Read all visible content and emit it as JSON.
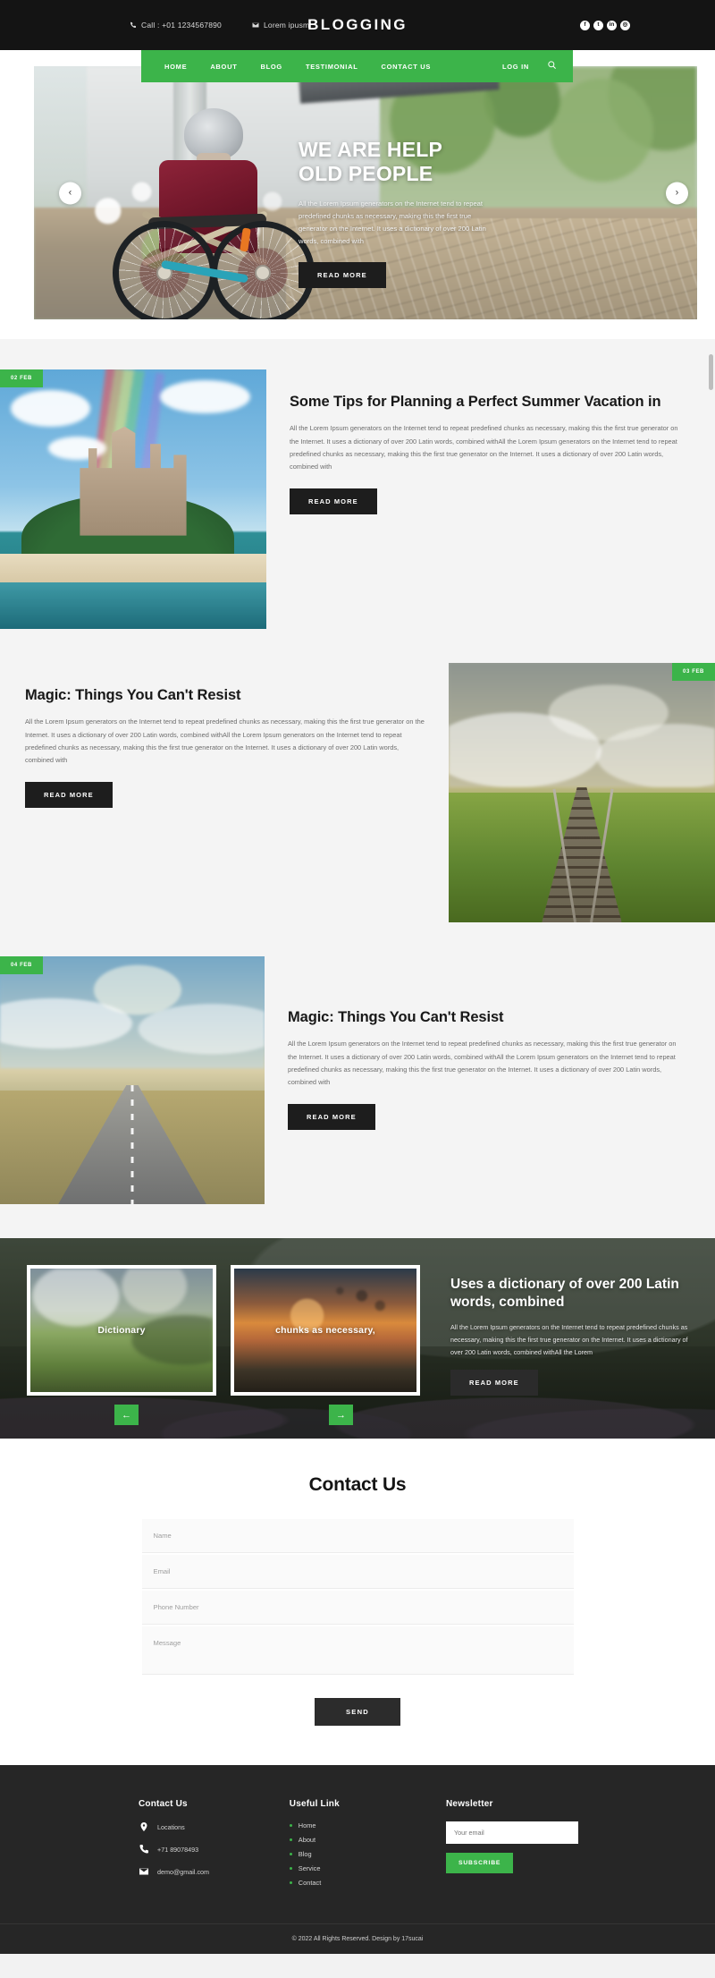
{
  "topbar": {
    "phone_icon": "phone-icon",
    "phone": "Call : +01 1234567890",
    "mail_icon": "mail-icon",
    "mail": "Lorem ipusm",
    "brand": "BLOGGING",
    "socials": [
      {
        "name": "facebook-icon",
        "glyph": "f"
      },
      {
        "name": "twitter-icon",
        "glyph": "t"
      },
      {
        "name": "linkedin-icon",
        "glyph": "in"
      },
      {
        "name": "instagram-icon",
        "glyph": "◎"
      }
    ]
  },
  "nav": {
    "items": [
      {
        "label": "HOME"
      },
      {
        "label": "ABOUT"
      },
      {
        "label": "BLOG"
      },
      {
        "label": "TESTIMONIAL"
      },
      {
        "label": "CONTACT US"
      }
    ],
    "login_label": "LOG IN",
    "search_icon": "search-icon",
    "accent_color": "#3cb44a"
  },
  "hero": {
    "title_line1": "WE ARE HELP",
    "title_line2": "OLD PEOPLE",
    "text": "All the Lorem Ipsum generators on the Internet tend to repeat predefined chunks as necessary, making this the first true generator on the Internet. It uses a dictionary of over 200 Latin words, combined with",
    "button": "READ MORE",
    "prev_icon": "chevron-left-icon",
    "next_icon": "chevron-right-icon",
    "prev_glyph": "‹",
    "next_glyph": "›"
  },
  "blog": {
    "posts": [
      {
        "date": "02 FEB",
        "title": "Some Tips for Planning a Perfect Summer Vacation in",
        "text": "All the Lorem Ipsum generators on the Internet tend to repeat predefined chunks as necessary, making this the first true generator on the Internet. It uses a dictionary of over 200 Latin words, combined withAll the Lorem Ipsum generators on the Internet tend to repeat predefined chunks as necessary, making this the first true generator on the Internet. It uses a dictionary of over 200 Latin words, combined with",
        "button": "READ MORE",
        "image": "castle-rainbow-photo"
      },
      {
        "date": "03 FEB",
        "title": "Magic: Things You Can't Resist",
        "text": "All the Lorem Ipsum generators on the Internet tend to repeat predefined chunks as necessary, making this the first true generator on the Internet. It uses a dictionary of over 200 Latin words, combined withAll the Lorem Ipsum generators on the Internet tend to repeat predefined chunks as necessary, making this the first true generator on the Internet. It uses a dictionary of over 200 Latin words, combined with",
        "button": "READ MORE",
        "image": "railway-track-photo"
      },
      {
        "date": "04 FEB",
        "title": "Magic: Things You Can't Resist",
        "text": "All the Lorem Ipsum generators on the Internet tend to repeat predefined chunks as necessary, making this the first true generator on the Internet. It uses a dictionary of over 200 Latin words, combined withAll the Lorem Ipsum generators on the Internet tend to repeat predefined chunks as necessary, making this the first true generator on the Internet. It uses a dictionary of over 200 Latin words, combined with",
        "button": "READ MORE",
        "image": "open-road-photo"
      }
    ]
  },
  "gallery": {
    "cards": [
      {
        "caption": "Dictionary",
        "image": "green-valley-photo"
      },
      {
        "caption": "chunks as necessary,",
        "image": "sunset-birds-photo"
      }
    ],
    "prev_icon": "arrow-left-icon",
    "next_icon": "arrow-right-icon",
    "prev_glyph": "←",
    "next_glyph": "→",
    "title": "Uses a dictionary of over 200 Latin words, combined",
    "text": "All the Lorem Ipsum generators on the Internet tend to repeat predefined chunks as necessary, making this the first true generator on the Internet. It uses a dictionary of over 200 Latin words, combined withAll the Lorem",
    "button": "READ MORE"
  },
  "contact": {
    "title": "Contact Us",
    "fields": [
      {
        "name": "name-field",
        "placeholder": "Name",
        "value": ""
      },
      {
        "name": "email-field",
        "placeholder": "Email",
        "value": ""
      },
      {
        "name": "phone-field",
        "placeholder": "Phone Number",
        "value": ""
      }
    ],
    "message_placeholder": "Message",
    "message_value": "",
    "send_label": "SEND"
  },
  "footer": {
    "contact_title": "Contact Us",
    "contact_items": [
      {
        "icon": "location-pin-icon",
        "label": "Locations"
      },
      {
        "icon": "phone-ring-icon",
        "label": "+71 89078493"
      },
      {
        "icon": "envelope-icon",
        "label": "demo@gmail.com"
      }
    ],
    "links_title": "Useful Link",
    "links": [
      {
        "label": "Home"
      },
      {
        "label": "About"
      },
      {
        "label": "Blog"
      },
      {
        "label": "Service"
      },
      {
        "label": "Contact"
      }
    ],
    "newsletter_title": "Newsletter",
    "newsletter_placeholder": "Your email",
    "newsletter_value": "",
    "subscribe_label": "SUBSCRIBE",
    "copyright": "© 2022 All Rights Reserved. Design by 17sucai"
  }
}
